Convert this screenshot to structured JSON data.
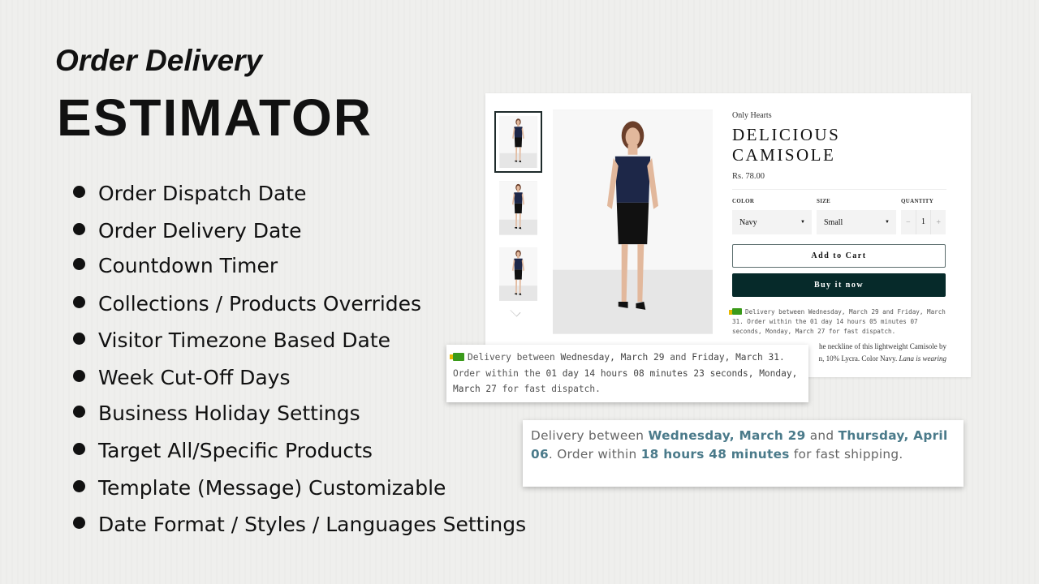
{
  "hero": {
    "title_line1": "Order Delivery",
    "title_line2": "ESTIMATOR"
  },
  "features": [
    "Order Dispatch Date",
    "Order Delivery Date",
    "Countdown Timer",
    "Collections / Products Overrides",
    "Visitor Timezone Based Date",
    "Week Cut-Off Days",
    "Business Holiday Settings",
    "Target All/Specific Products",
    "Template (Message) Customizable",
    "Date Format / Styles / Languages Settings"
  ],
  "product": {
    "vendor": "Only Hearts",
    "title": "DELICIOUS CAMISOLE",
    "price": "Rs. 78.00",
    "color_label": "COLOR",
    "color_value": "Navy",
    "size_label": "SIZE",
    "size_value": "Small",
    "quantity_label": "QUANTITY",
    "quantity_value": "1",
    "qty_minus": "−",
    "qty_plus": "+",
    "add_to_cart": "Add to Cart",
    "buy_now": "Buy it now",
    "delivery_message": "Delivery between Wednesday, March 29 and Friday, March 31. Order within the 01 day 14 hours 05 minutes 07 seconds, Monday, March 27 for fast dispatch.",
    "description_line1": "he neckline of this lightweight Camisole by",
    "description_line2": "n, 10% Lycra. Color Navy.",
    "description_italic": "Lana is wearing"
  },
  "popup1": {
    "p1": "Delivery between ",
    "d1": "Wednesday, March 29",
    "p2": " and ",
    "d2": "Friday, March 31",
    "p3": ". Order within the ",
    "t": "01 day 14 hours 08 minutes 23 seconds, Monday, March 27",
    "p4": " for fast dispatch."
  },
  "popup2": {
    "p1": "Delivery between ",
    "d1": "Wednesday, March 29",
    "p2": " and ",
    "d2": "Thursday, April 06",
    "p3": ". Order within ",
    "t": "18 hours 48 minutes",
    "p4": " for fast shipping."
  },
  "colors": {
    "buy_button": "#062a2a",
    "highlight": "#4a7a8a",
    "truck": "#3a9a1a"
  },
  "icons": {
    "truck": "truck-icon",
    "dropdown": "caret-down-icon",
    "more": "chevron-down-icon"
  }
}
